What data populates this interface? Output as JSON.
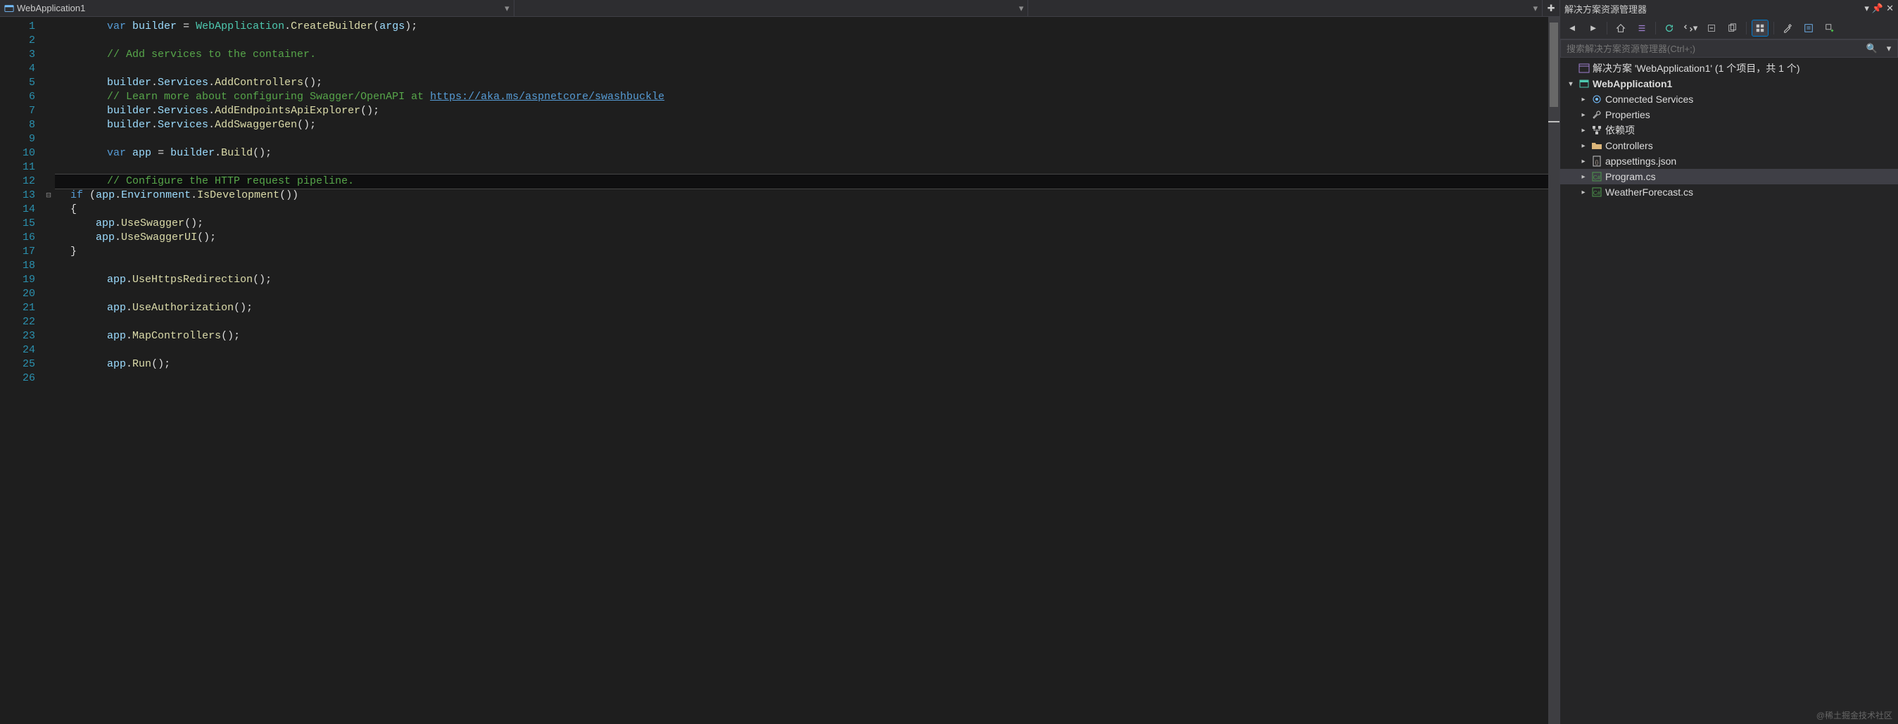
{
  "nav": {
    "slot1": "WebApplication1",
    "slot2": "",
    "slot3": ""
  },
  "code": {
    "lines": [
      {
        "n": 1,
        "html": "<span class='c-kw'>var</span> <span class='c-var'>builder</span> <span class='c-pun'>=</span> <span class='c-type'>WebApplication</span><span class='c-pun'>.</span><span class='c-mem'>CreateBuilder</span><span class='c-pun'>(</span><span class='c-var'>args</span><span class='c-pun'>);</span>"
      },
      {
        "n": 2,
        "html": ""
      },
      {
        "n": 3,
        "html": "<span class='c-com'>// Add services to the container.</span>"
      },
      {
        "n": 4,
        "html": ""
      },
      {
        "n": 5,
        "html": "<span class='c-var'>builder</span><span class='c-pun'>.</span><span class='c-var'>Services</span><span class='c-pun'>.</span><span class='c-mem'>AddControllers</span><span class='c-pun'>();</span>"
      },
      {
        "n": 6,
        "html": "<span class='c-com'>// Learn more about configuring Swagger/OpenAPI at </span><span class='c-link'>https://aka.ms/aspnetcore/swashbuckle</span>"
      },
      {
        "n": 7,
        "html": "<span class='c-var'>builder</span><span class='c-pun'>.</span><span class='c-var'>Services</span><span class='c-pun'>.</span><span class='c-mem'>AddEndpointsApiExplorer</span><span class='c-pun'>();</span>"
      },
      {
        "n": 8,
        "html": "<span class='c-var'>builder</span><span class='c-pun'>.</span><span class='c-var'>Services</span><span class='c-pun'>.</span><span class='c-mem'>AddSwaggerGen</span><span class='c-pun'>();</span>"
      },
      {
        "n": 9,
        "html": ""
      },
      {
        "n": 10,
        "html": "<span class='c-kw'>var</span> <span class='c-var'>app</span> <span class='c-pun'>=</span> <span class='c-var'>builder</span><span class='c-pun'>.</span><span class='c-mem'>Build</span><span class='c-pun'>();</span>"
      },
      {
        "n": 11,
        "html": ""
      },
      {
        "n": 12,
        "html": "<span class='c-com'>// Configure the HTTP request pipeline.</span>",
        "current": true
      },
      {
        "n": 13,
        "html": "<span class='c-kw'>if</span> <span class='c-pun'>(</span><span class='c-var'>app</span><span class='c-pun'>.</span><span class='c-var'>Environment</span><span class='c-pun'>.</span><span class='c-mem'>IsDevelopment</span><span class='c-pun'>())</span>",
        "fold": "⊟"
      },
      {
        "n": 14,
        "html": "<span class='c-pun'>{</span>"
      },
      {
        "n": 15,
        "html": "    <span class='c-var'>app</span><span class='c-pun'>.</span><span class='c-mem'>UseSwagger</span><span class='c-pun'>();</span>"
      },
      {
        "n": 16,
        "html": "    <span class='c-var'>app</span><span class='c-pun'>.</span><span class='c-mem'>UseSwaggerUI</span><span class='c-pun'>();</span>"
      },
      {
        "n": 17,
        "html": "<span class='c-pun'>}</span>"
      },
      {
        "n": 18,
        "html": ""
      },
      {
        "n": 19,
        "html": "<span class='c-var'>app</span><span class='c-pun'>.</span><span class='c-mem'>UseHttpsRedirection</span><span class='c-pun'>();</span>"
      },
      {
        "n": 20,
        "html": ""
      },
      {
        "n": 21,
        "html": "<span class='c-var'>app</span><span class='c-pun'>.</span><span class='c-mem'>UseAuthorization</span><span class='c-pun'>();</span>"
      },
      {
        "n": 22,
        "html": ""
      },
      {
        "n": 23,
        "html": "<span class='c-var'>app</span><span class='c-pun'>.</span><span class='c-mem'>MapControllers</span><span class='c-pun'>();</span>"
      },
      {
        "n": 24,
        "html": ""
      },
      {
        "n": 25,
        "html": "<span class='c-var'>app</span><span class='c-pun'>.</span><span class='c-mem'>Run</span><span class='c-pun'>();</span>"
      },
      {
        "n": 26,
        "html": ""
      }
    ],
    "indent_base": "        "
  },
  "solutionExplorer": {
    "title": "解决方案资源管理器",
    "searchPlaceholder": "搜索解决方案资源管理器(Ctrl+;)",
    "tree": [
      {
        "depth": 0,
        "exp": "",
        "icon": "sln",
        "label": "解决方案 'WebApplication1' (1 个项目，共 1 个)"
      },
      {
        "depth": 0,
        "exp": "▾",
        "icon": "proj",
        "label": "WebApplication1",
        "bold": true
      },
      {
        "depth": 1,
        "exp": "▸",
        "icon": "conn",
        "label": "Connected Services"
      },
      {
        "depth": 1,
        "exp": "▸",
        "icon": "wrench",
        "label": "Properties"
      },
      {
        "depth": 1,
        "exp": "▸",
        "icon": "dep",
        "label": "依赖项"
      },
      {
        "depth": 1,
        "exp": "▸",
        "icon": "folder",
        "label": "Controllers"
      },
      {
        "depth": 1,
        "exp": "▸",
        "icon": "json",
        "label": "appsettings.json"
      },
      {
        "depth": 1,
        "exp": "▸",
        "icon": "cs",
        "label": "Program.cs",
        "selected": true
      },
      {
        "depth": 1,
        "exp": "▸",
        "icon": "cs",
        "label": "WeatherForecast.cs"
      }
    ]
  },
  "watermark": "@稀土掘金技术社区"
}
